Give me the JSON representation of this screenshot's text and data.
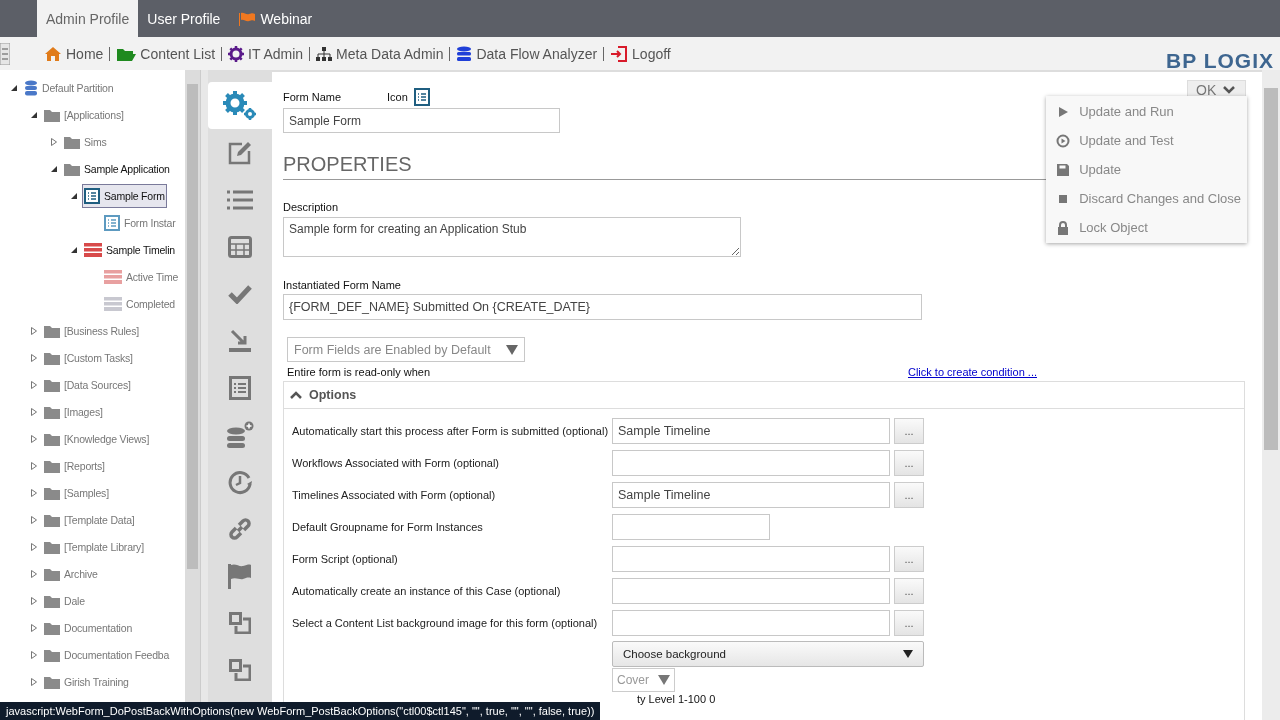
{
  "top_tabs": [
    {
      "label": "Admin Profile",
      "selected": true,
      "kind": "plain"
    },
    {
      "label": "User Profile",
      "selected": false,
      "kind": "plain"
    },
    {
      "label": "Webinar",
      "selected": false,
      "kind": "flag"
    }
  ],
  "nav": [
    {
      "label": "Home",
      "kind": "home"
    },
    {
      "label": "Content List",
      "kind": "folder"
    },
    {
      "label": "IT Admin",
      "kind": "gear"
    },
    {
      "label": "Meta Data Admin",
      "kind": "sitemap"
    },
    {
      "label": "Data Flow Analyzer",
      "kind": "database"
    },
    {
      "label": "Logoff",
      "kind": "logoff"
    }
  ],
  "logo": "BP LOGIX",
  "tree": [
    {
      "label": "Default Partition",
      "kind": "partition",
      "expanded": true,
      "selected": false,
      "highlighted": false,
      "children": [
        {
          "label": "[Applications]",
          "kind": "folder",
          "expanded": true,
          "selected": false,
          "highlighted": false,
          "children": [
            {
              "label": "Sims",
              "kind": "folder",
              "expanded": false,
              "selected": false,
              "highlighted": false
            },
            {
              "label": "Sample Application",
              "kind": "folder",
              "expanded": true,
              "selected": false,
              "highlighted": true,
              "children": [
                {
                  "label": "Sample Form",
                  "kind": "form",
                  "expanded": true,
                  "selected": true,
                  "highlighted": true,
                  "children": [
                    {
                      "label": "Form Instar",
                      "kind": "instances",
                      "selected": false,
                      "highlighted": false
                    }
                  ]
                },
                {
                  "label": "Sample Timelin",
                  "kind": "timeline",
                  "expanded": true,
                  "selected": false,
                  "highlighted": true,
                  "children": [
                    {
                      "label": "Active Time",
                      "kind": "active",
                      "selected": false,
                      "highlighted": false
                    },
                    {
                      "label": "Completed",
                      "kind": "completed",
                      "selected": false,
                      "highlighted": false
                    }
                  ]
                }
              ]
            }
          ]
        },
        {
          "label": "[Business Rules]",
          "kind": "folder",
          "expanded": false,
          "selected": false,
          "highlighted": false
        },
        {
          "label": "[Custom Tasks]",
          "kind": "folder",
          "expanded": false,
          "selected": false,
          "highlighted": false
        },
        {
          "label": "[Data Sources]",
          "kind": "folder",
          "expanded": false,
          "selected": false,
          "highlighted": false
        },
        {
          "label": "[Images]",
          "kind": "folder",
          "expanded": false,
          "selected": false,
          "highlighted": false
        },
        {
          "label": "[Knowledge Views]",
          "kind": "folder",
          "expanded": false,
          "selected": false,
          "highlighted": false
        },
        {
          "label": "[Reports]",
          "kind": "folder",
          "expanded": false,
          "selected": false,
          "highlighted": false
        },
        {
          "label": "[Samples]",
          "kind": "folder",
          "expanded": false,
          "selected": false,
          "highlighted": false
        },
        {
          "label": "[Template Data]",
          "kind": "folder",
          "expanded": false,
          "selected": false,
          "highlighted": false
        },
        {
          "label": "[Template Library]",
          "kind": "folder",
          "expanded": false,
          "selected": false,
          "highlighted": false
        },
        {
          "label": "Archive",
          "kind": "folder",
          "expanded": false,
          "selected": false,
          "highlighted": false
        },
        {
          "label": "Dale",
          "kind": "folder",
          "expanded": false,
          "selected": false,
          "highlighted": false
        },
        {
          "label": "Documentation",
          "kind": "folder",
          "expanded": false,
          "selected": false,
          "highlighted": false
        },
        {
          "label": "Documentation Feedba",
          "kind": "folder",
          "expanded": false,
          "selected": false,
          "highlighted": false
        },
        {
          "label": "Girish Training",
          "kind": "folder",
          "expanded": false,
          "selected": false,
          "highlighted": false
        }
      ]
    }
  ],
  "rail": [
    {
      "kind": "gears",
      "selected": true
    },
    {
      "kind": "edit",
      "selected": false
    },
    {
      "kind": "list",
      "selected": false
    },
    {
      "kind": "table",
      "selected": false
    },
    {
      "kind": "check",
      "selected": false
    },
    {
      "kind": "import",
      "selected": false
    },
    {
      "kind": "form",
      "selected": false
    },
    {
      "kind": "database-plus",
      "selected": false
    },
    {
      "kind": "clock",
      "selected": false
    },
    {
      "kind": "link",
      "selected": false
    },
    {
      "kind": "flag",
      "selected": false
    },
    {
      "kind": "squares",
      "selected": false
    },
    {
      "kind": "squares",
      "selected": false
    }
  ],
  "form": {
    "name_label": "Form Name",
    "icon_label": "Icon",
    "name_value": "Sample Form",
    "heading": "PROPERTIES",
    "description_label": "Description",
    "description_value": "Sample form for creating an Application Stub",
    "instantiated_label": "Instantiated Form Name",
    "instantiated_value": "{FORM_DEF_NAME} Submitted On {CREATE_DATE}",
    "fields_select": "Form Fields are Enabled by Default",
    "readonly_label": "Entire form is read-only when",
    "condition_link": "Click to create condition ..."
  },
  "options": {
    "title": "Options",
    "expanded": true,
    "rows": [
      {
        "label": "Automatically start this process after Form is submitted (optional)",
        "value": "Sample Timeline",
        "button": "..."
      },
      {
        "label": "Workflows Associated with Form (optional)",
        "button": "..."
      },
      {
        "label": "Timelines Associated with Form (optional)",
        "value": "Sample Timeline",
        "button": "..."
      },
      {
        "label": "Default Groupname for Form Instances"
      },
      {
        "label": "Form Script (optional)",
        "button": "..."
      },
      {
        "label": "Automatically create an instance of this Case (optional)",
        "button": "..."
      },
      {
        "label": "Select a Content List background image for this form (optional)",
        "button": "..."
      }
    ],
    "background_select": "Choose background",
    "fit_select": "Cover",
    "partial_text": "ty Level 1-100 0"
  },
  "ok_button": "OK",
  "ok_menu": [
    {
      "label": "Update and Run",
      "kind": "run"
    },
    {
      "label": "Update and Test",
      "kind": "test"
    },
    {
      "label": "Update",
      "kind": "save"
    },
    {
      "label": "Discard Changes and Close",
      "kind": "stop"
    },
    {
      "label": "Lock Object",
      "kind": "lock"
    }
  ],
  "status_text": "javascript:WebForm_DoPostBackWithOptions(new WebForm_PostBackOptions(\"ctl00$ctl145\", \"\", true, \"\", \"\", false, true))"
}
